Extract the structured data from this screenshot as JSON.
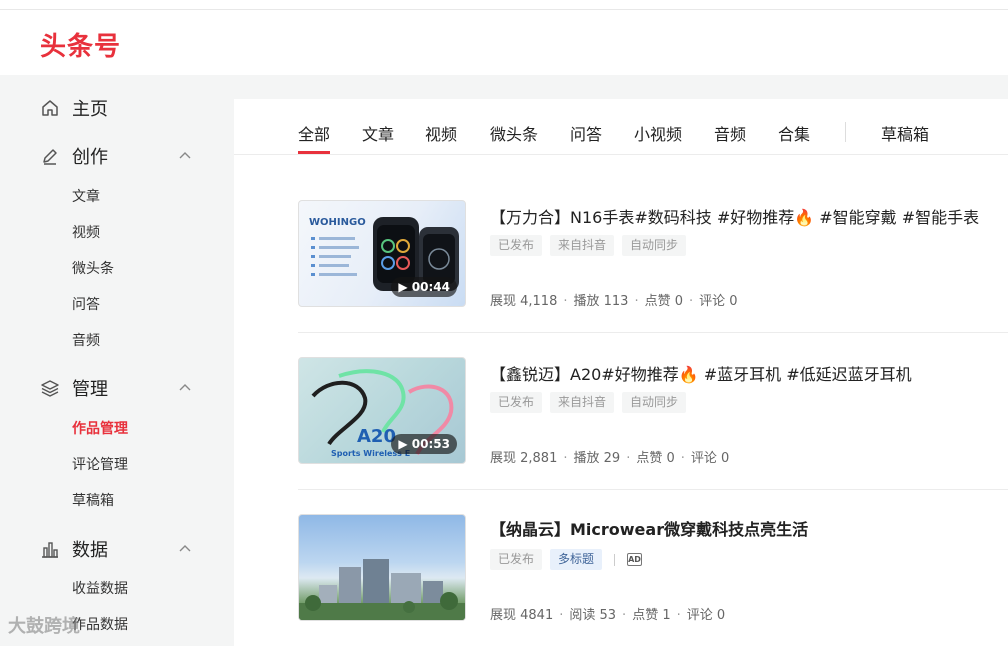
{
  "brand": {
    "logo_text": "头条号",
    "accent": "#e8313c"
  },
  "sidebar": {
    "home": "主页",
    "create": {
      "label": "创作",
      "items": [
        "文章",
        "视频",
        "微头条",
        "问答",
        "音频"
      ]
    },
    "manage": {
      "label": "管理",
      "items": [
        "作品管理",
        "评论管理",
        "草稿箱"
      ],
      "active": "作品管理"
    },
    "data": {
      "label": "数据",
      "items": [
        "收益数据",
        "作品数据"
      ]
    }
  },
  "tabs": [
    "全部",
    "文章",
    "视频",
    "微头条",
    "问答",
    "小视频",
    "音频",
    "合集",
    "草稿箱"
  ],
  "active_tab": "全部",
  "items": [
    {
      "title": "【万力合】N16手表#数码科技 #好物推荐🔥 #智能穿戴 #智能手表",
      "tags": [
        "已发布",
        "来自抖音",
        "自动同步"
      ],
      "duration": "00:44",
      "thumb_text": "WOHINGO",
      "stats": [
        "展现 4,118",
        "播放 113",
        "点赞 0",
        "评论 0"
      ]
    },
    {
      "title": "【鑫锐迈】A20#好物推荐🔥 #蓝牙耳机 #低延迟蓝牙耳机",
      "tags": [
        "已发布",
        "来自抖音",
        "自动同步"
      ],
      "duration": "00:53",
      "thumb_text": "A20",
      "thumb_subtext": "Sports Wireless E",
      "stats": [
        "展现 2,881",
        "播放 29",
        "点赞 0",
        "评论 0"
      ]
    },
    {
      "title": "【纳晶云】Microwear微穿戴科技点亮生活",
      "tags": [
        "已发布",
        "多标题"
      ],
      "ad_label": "AD",
      "stats": [
        "展现 4841",
        "阅读 53",
        "点赞 1",
        "评论 0"
      ]
    }
  ],
  "watermark": "大鼓跨境"
}
